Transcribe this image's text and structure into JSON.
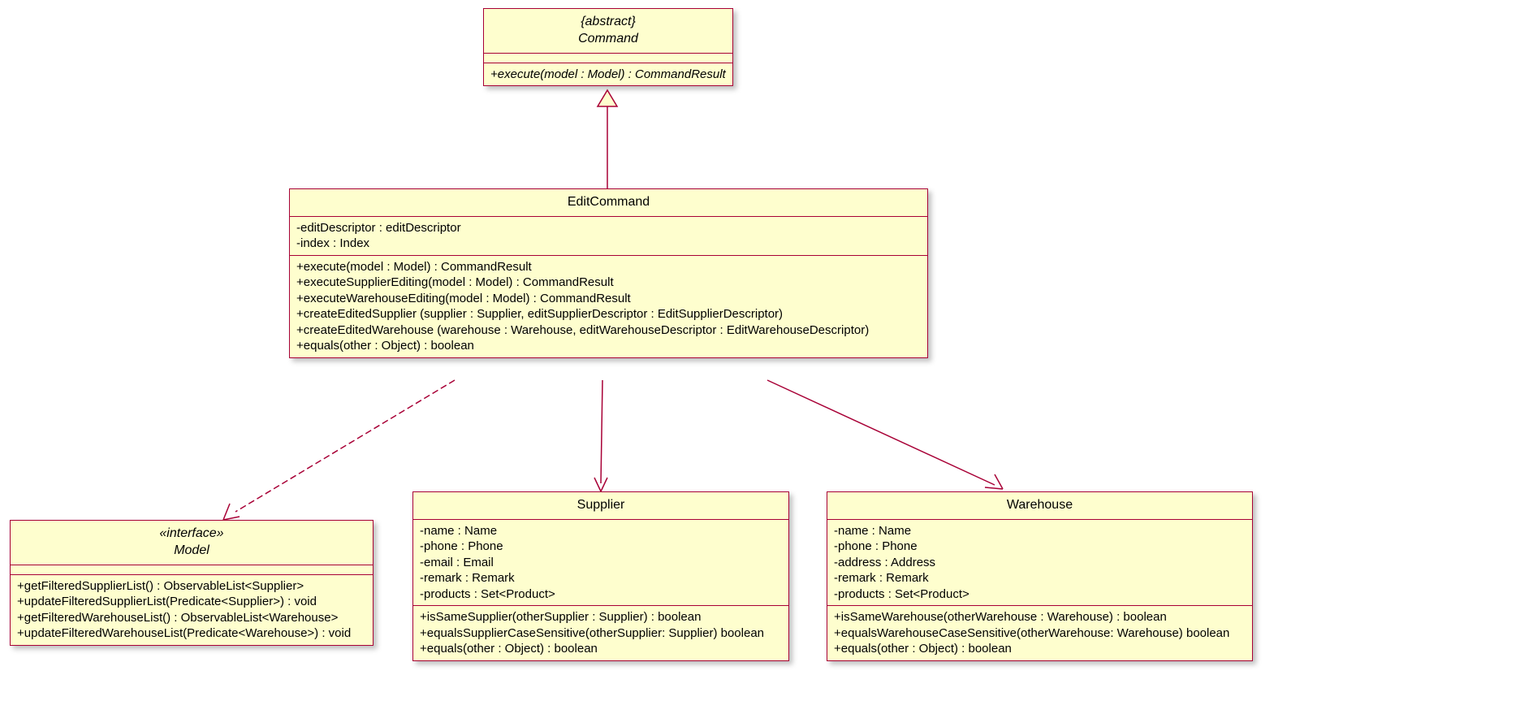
{
  "command": {
    "stereotype": "{abstract}",
    "name": "Command",
    "methods": {
      "execute": "+execute(model : Model) : CommandResult"
    }
  },
  "editCommand": {
    "name": "EditCommand",
    "attrs": {
      "editDescriptor": "-editDescriptor : editDescriptor",
      "index": "-index : Index"
    },
    "methods": {
      "execute": "+execute(model : Model) : CommandResult",
      "executeSupplierEditing": "+executeSupplierEditing(model : Model) : CommandResult",
      "executeWarehouseEditing": "+executeWarehouseEditing(model : Model) : CommandResult",
      "createEditedSupplier": "+createEditedSupplier (supplier : Supplier, editSupplierDescriptor : EditSupplierDescriptor)",
      "createEditedWarehouse": "+createEditedWarehouse (warehouse : Warehouse, editWarehouseDescriptor : EditWarehouseDescriptor)",
      "equals": "+equals(other : Object) : boolean"
    }
  },
  "model": {
    "stereotype": "«interface»",
    "name": "Model",
    "methods": {
      "m1": "+getFilteredSupplierList() : ObservableList<Supplier>",
      "m2": "+updateFilteredSupplierList(Predicate<Supplier>) : void",
      "m3": "+getFilteredWarehouseList() : ObservableList<Warehouse>",
      "m4": "+updateFilteredWarehouseList(Predicate<Warehouse>) : void"
    }
  },
  "supplier": {
    "name": "Supplier",
    "attrs": {
      "name": "-name : Name",
      "phone": "-phone : Phone",
      "email": "-email : Email",
      "remark": "-remark : Remark",
      "products": "-products : Set<Product>"
    },
    "methods": {
      "m1": "+isSameSupplier(otherSupplier : Supplier) : boolean",
      "m2": "+equalsSupplierCaseSensitive(otherSupplier: Supplier) boolean",
      "m3": "+equals(other : Object) : boolean"
    }
  },
  "warehouse": {
    "name": "Warehouse",
    "attrs": {
      "name": "-name : Name",
      "phone": "-phone : Phone",
      "address": "-address : Address",
      "remark": "-remark : Remark",
      "products": "-products : Set<Product>"
    },
    "methods": {
      "m1": "+isSameWarehouse(otherWarehouse : Warehouse) : boolean",
      "m2": "+equalsWarehouseCaseSensitive(otherWarehouse: Warehouse) boolean",
      "m3": "+equals(other : Object) : boolean"
    }
  }
}
